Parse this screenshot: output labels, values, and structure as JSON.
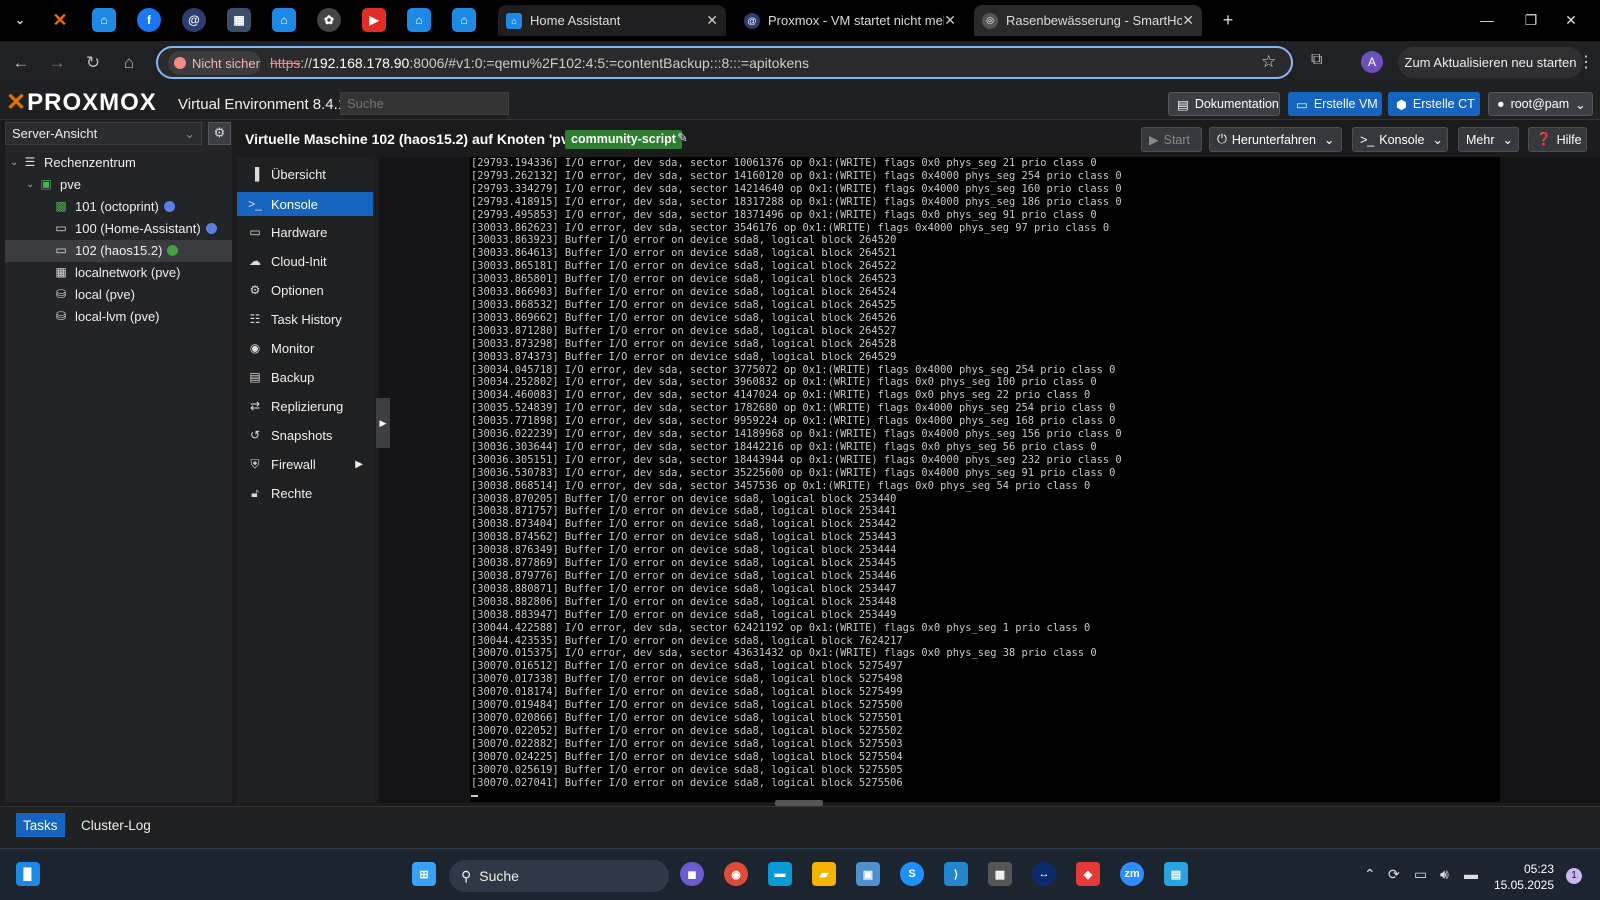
{
  "browser": {
    "tabs": [
      {
        "title": "Home Assistant",
        "favicon": "home-assistant-icon"
      },
      {
        "title": "Proxmox - VM startet nicht mel",
        "favicon": "forum-icon"
      },
      {
        "title": "Rasenbewässerung - SmartHom",
        "favicon": "community-icon"
      }
    ],
    "security_label": "Nicht sicher",
    "url_proto": "https",
    "url_host": "192.168.178.90",
    "url_rest": ":8006/#v1:0:=qemu%2F102:4:5:=contentBackup:::8:::=apitokens",
    "profile_initial": "A",
    "update_label": "Zum Aktualisieren neu starten"
  },
  "proxmox": {
    "logo": "PROXMOX",
    "version": "Virtual Environment 8.4.1",
    "search_placeholder": "Suche",
    "buttons": {
      "docs": "Dokumentation",
      "create_vm": "Erstelle VM",
      "create_ct": "Erstelle CT",
      "user": "root@pam"
    },
    "view_selector": "Server-Ansicht",
    "tree": {
      "datacenter": "Rechenzentrum",
      "node": "pve",
      "items": [
        {
          "label": "101 (octoprint)",
          "status_color": "#5c7fe0"
        },
        {
          "label": "100 (Home-Assistant)",
          "status_color": "#5c7fe0"
        },
        {
          "label": "102 (haos15.2)",
          "status_color": "#43a047"
        },
        {
          "label": "localnetwork (pve)"
        },
        {
          "label": "local (pve)"
        },
        {
          "label": "local-lvm (pve)"
        }
      ]
    },
    "vm_title": "Virtuelle Maschine 102 (haos15.2) auf Knoten 'pve'",
    "tag": "community-script",
    "toolbar": {
      "start": "Start",
      "shutdown": "Herunterfahren",
      "console": "Konsole",
      "more": "Mehr",
      "help": "Hilfe"
    },
    "nav": [
      {
        "label": "Übersicht",
        "icon": "overview-icon"
      },
      {
        "label": "Konsole",
        "icon": "console-icon",
        "active": true
      },
      {
        "label": "Hardware",
        "icon": "monitor-icon"
      },
      {
        "label": "Cloud-Init",
        "icon": "cloud-icon"
      },
      {
        "label": "Optionen",
        "icon": "gear-icon"
      },
      {
        "label": "Task History",
        "icon": "list-icon"
      },
      {
        "label": "Monitor",
        "icon": "eye-icon"
      },
      {
        "label": "Backup",
        "icon": "floppy-icon"
      },
      {
        "label": "Replizierung",
        "icon": "retweet-icon"
      },
      {
        "label": "Snapshots",
        "icon": "history-icon"
      },
      {
        "label": "Firewall",
        "icon": "shield-icon"
      },
      {
        "label": "Rechte",
        "icon": "unlock-icon"
      }
    ],
    "bottom_tabs": {
      "tasks": "Tasks",
      "cluster_log": "Cluster-Log"
    }
  },
  "console_lines": [
    "[29793.194336] I/O error, dev sda, sector 10061376 op 0x1:(WRITE) flags 0x0 phys_seg 21 prio class 0",
    "[29793.262132] I/O error, dev sda, sector 14160120 op 0x1:(WRITE) flags 0x4000 phys_seg 254 prio class 0",
    "[29793.334279] I/O error, dev sda, sector 14214640 op 0x1:(WRITE) flags 0x4000 phys_seg 160 prio class 0",
    "[29793.418915] I/O error, dev sda, sector 18317288 op 0x1:(WRITE) flags 0x4000 phys_seg 186 prio class 0",
    "[29793.495853] I/O error, dev sda, sector 18371496 op 0x1:(WRITE) flags 0x0 phys_seg 91 prio class 0",
    "[30033.862623] I/O error, dev sda, sector 3546176 op 0x1:(WRITE) flags 0x4000 phys_seg 97 prio class 0",
    "[30033.863923] Buffer I/O error on device sda8, logical block 264520",
    "[30033.864613] Buffer I/O error on device sda8, logical block 264521",
    "[30033.865181] Buffer I/O error on device sda8, logical block 264522",
    "[30033.865801] Buffer I/O error on device sda8, logical block 264523",
    "[30033.866903] Buffer I/O error on device sda8, logical block 264524",
    "[30033.868532] Buffer I/O error on device sda8, logical block 264525",
    "[30033.869662] Buffer I/O error on device sda8, logical block 264526",
    "[30033.871280] Buffer I/O error on device sda8, logical block 264527",
    "[30033.873298] Buffer I/O error on device sda8, logical block 264528",
    "[30033.874373] Buffer I/O error on device sda8, logical block 264529",
    "[30034.045718] I/O error, dev sda, sector 3775072 op 0x1:(WRITE) flags 0x4000 phys_seg 254 prio class 0",
    "[30034.252802] I/O error, dev sda, sector 3960832 op 0x1:(WRITE) flags 0x0 phys_seg 100 prio class 0",
    "[30034.460083] I/O error, dev sda, sector 4147024 op 0x1:(WRITE) flags 0x0 phys_seg 22 prio class 0",
    "[30035.524839] I/O error, dev sda, sector 1782680 op 0x1:(WRITE) flags 0x4000 phys_seg 254 prio class 0",
    "[30035.771898] I/O error, dev sda, sector 9959224 op 0x1:(WRITE) flags 0x4000 phys_seg 168 prio class 0",
    "[30036.022239] I/O error, dev sda, sector 14189968 op 0x1:(WRITE) flags 0x4000 phys_seg 156 prio class 0",
    "[30036.303644] I/O error, dev sda, sector 18442216 op 0x1:(WRITE) flags 0x0 phys_seg 56 prio class 0",
    "[30036.305151] I/O error, dev sda, sector 18443944 op 0x1:(WRITE) flags 0x4000 phys_seg 232 prio class 0",
    "[30036.530783] I/O error, dev sda, sector 35225600 op 0x1:(WRITE) flags 0x4000 phys_seg 91 prio class 0",
    "[30038.868514] I/O error, dev sda, sector 3457536 op 0x1:(WRITE) flags 0x0 phys_seg 54 prio class 0",
    "[30038.870205] Buffer I/O error on device sda8, logical block 253440",
    "[30038.871757] Buffer I/O error on device sda8, logical block 253441",
    "[30038.873404] Buffer I/O error on device sda8, logical block 253442",
    "[30038.874562] Buffer I/O error on device sda8, logical block 253443",
    "[30038.876349] Buffer I/O error on device sda8, logical block 253444",
    "[30038.877869] Buffer I/O error on device sda8, logical block 253445",
    "[30038.879776] Buffer I/O error on device sda8, logical block 253446",
    "[30038.880871] Buffer I/O error on device sda8, logical block 253447",
    "[30038.882806] Buffer I/O error on device sda8, logical block 253448",
    "[30038.883947] Buffer I/O error on device sda8, logical block 253449",
    "[30044.422588] I/O error, dev sda, sector 62421192 op 0x1:(WRITE) flags 0x0 phys_seg 1 prio class 0",
    "[30044.423535] Buffer I/O error on device sda8, logical block 7624217",
    "[30070.015375] I/O error, dev sda, sector 43631432 op 0x1:(WRITE) flags 0x0 phys_seg 38 prio class 0",
    "[30070.016512] Buffer I/O error on device sda8, logical block 5275497",
    "[30070.017338] Buffer I/O error on device sda8, logical block 5275498",
    "[30070.018174] Buffer I/O error on device sda8, logical block 5275499",
    "[30070.019484] Buffer I/O error on device sda8, logical block 5275500",
    "[30070.020866] Buffer I/O error on device sda8, logical block 5275501",
    "[30070.022052] Buffer I/O error on device sda8, logical block 5275502",
    "[30070.022882] Buffer I/O error on device sda8, logical block 5275503",
    "[30070.024225] Buffer I/O error on device sda8, logical block 5275504",
    "[30070.025619] Buffer I/O error on device sda8, logical block 5275505",
    "[30070.027041] Buffer I/O error on device sda8, logical block 5275506"
  ],
  "taskbar": {
    "search_label": "Suche",
    "time": "05:23",
    "date": "15.05.2025",
    "notification_count": "1"
  },
  "colors": {
    "accent": "#1565c0",
    "tag": "#2e7d32",
    "proxmox_orange": "#e57000",
    "running": "#43a047"
  }
}
